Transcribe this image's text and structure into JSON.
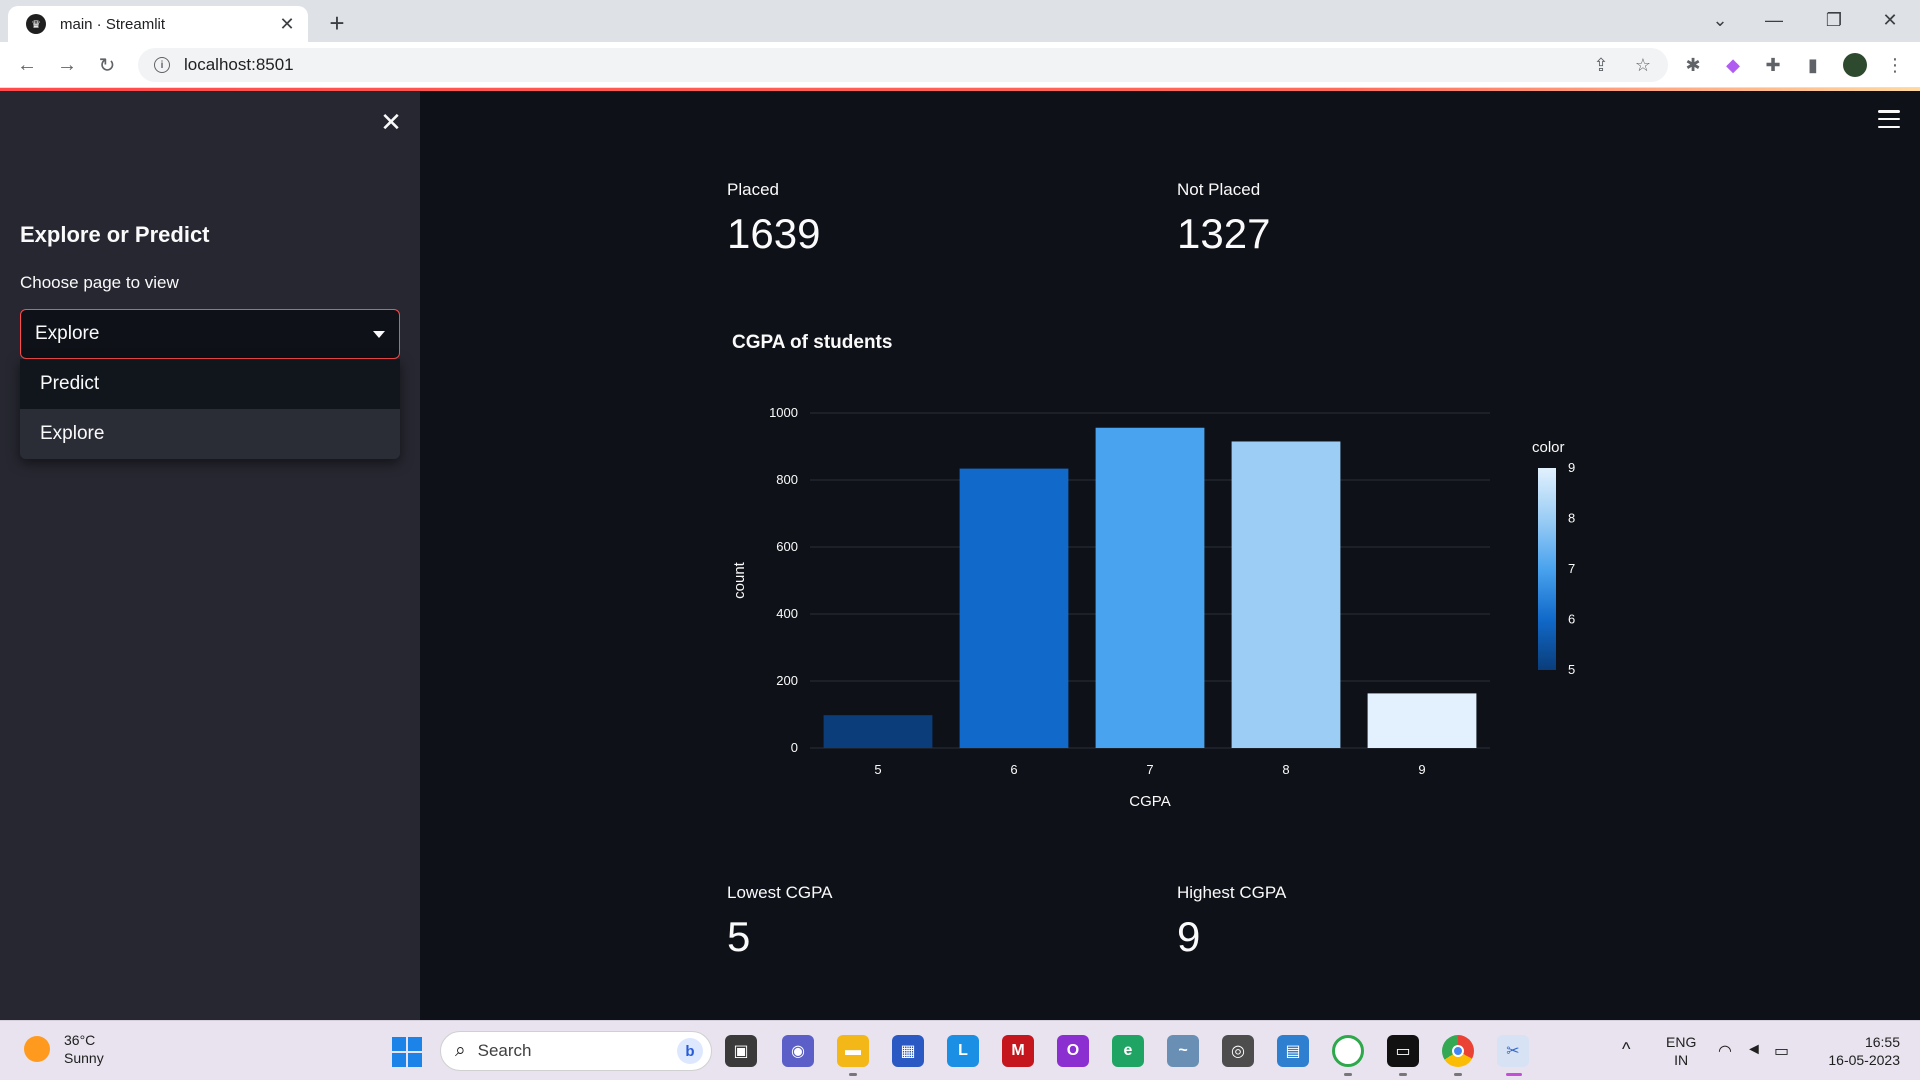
{
  "browser": {
    "tab_title": "main · Streamlit",
    "url": "localhost:8501"
  },
  "sidebar": {
    "heading": "Explore or Predict",
    "select_label": "Choose page to view",
    "select_value": "Explore",
    "options": [
      "Predict",
      "Explore"
    ]
  },
  "metrics": {
    "placed": {
      "label": "Placed",
      "value": "1639"
    },
    "not_placed": {
      "label": "Not Placed",
      "value": "1327"
    },
    "lowest": {
      "label": "Lowest CGPA",
      "value": "5"
    },
    "highest": {
      "label": "Highest CGPA",
      "value": "9"
    }
  },
  "chart_data": {
    "type": "bar",
    "title": "CGPA of students",
    "xlabel": "CGPA",
    "ylabel": "count",
    "categories": [
      "5",
      "6",
      "7",
      "8",
      "9"
    ],
    "values": [
      98,
      834,
      956,
      915,
      163
    ],
    "ylim": [
      0,
      1000
    ],
    "yticks": [
      0,
      200,
      400,
      600,
      800,
      1000
    ],
    "grid": true,
    "colorbar": {
      "title": "color",
      "ticks": [
        5,
        6,
        7,
        8,
        9
      ]
    },
    "bar_colors": [
      "#0a3d7a",
      "#1169c9",
      "#4aa3ee",
      "#9ccdf5",
      "#e2f1fd"
    ]
  },
  "taskbar": {
    "weather_temp": "36°C",
    "weather_desc": "Sunny",
    "search_placeholder": "Search",
    "lang_line1": "ENG",
    "lang_line2": "IN",
    "time": "16:55",
    "date": "16-05-2023"
  }
}
